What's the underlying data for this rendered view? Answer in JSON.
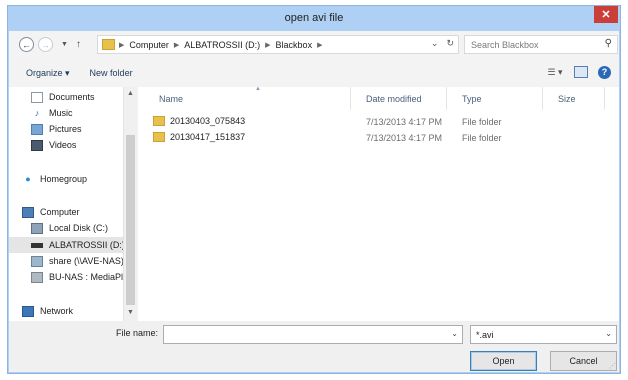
{
  "window": {
    "title": "open avi file",
    "close_glyph": "✕"
  },
  "nav": {
    "back_icon": "arrow-left-icon",
    "forward_icon": "arrow-right-icon",
    "breadcrumbs": [
      "Computer",
      "ALBATROSSII (D:)",
      "Blackbox"
    ],
    "search_placeholder": "Search Blackbox"
  },
  "toolbar": {
    "organize_label": "Organize ▾",
    "new_folder_label": "New folder"
  },
  "sidebar": {
    "items": [
      {
        "label": "Documents",
        "icon": "documents-icon",
        "group": "libraries"
      },
      {
        "label": "Music",
        "icon": "music-icon",
        "group": "libraries"
      },
      {
        "label": "Pictures",
        "icon": "pictures-icon",
        "group": "libraries"
      },
      {
        "label": "Videos",
        "icon": "videos-icon",
        "group": "libraries"
      },
      {
        "label": "Homegroup",
        "icon": "homegroup-icon",
        "group": "homegroup"
      },
      {
        "label": "Computer",
        "icon": "computer-icon",
        "group": "computer"
      },
      {
        "label": "Local Disk (C:)",
        "icon": "local-disk-icon",
        "group": "computer"
      },
      {
        "label": "ALBATROSSII (D:)",
        "icon": "drive-icon",
        "group": "computer",
        "selected": true
      },
      {
        "label": "share (\\\\AVE-NAS)",
        "icon": "network-drive-icon",
        "group": "computer"
      },
      {
        "label": "BU-NAS : MediaPlayer",
        "icon": "media-server-icon",
        "group": "computer"
      },
      {
        "label": "Network",
        "icon": "network-icon",
        "group": "network"
      }
    ]
  },
  "columns": [
    "Name",
    "Date modified",
    "Type",
    "Size"
  ],
  "files": [
    {
      "name": "20130403_075843",
      "date": "7/13/2013 4:17 PM",
      "type": "File folder",
      "size": ""
    },
    {
      "name": "20130417_151837",
      "date": "7/13/2013 4:17 PM",
      "type": "File folder",
      "size": ""
    }
  ],
  "footer": {
    "file_name_label": "File name:",
    "file_name_value": "",
    "file_type_value": "*.avi",
    "open_label": "Open",
    "cancel_label": "Cancel"
  },
  "colors": {
    "title_bar": "#aed0f5",
    "close_button": "#c9403a",
    "folder": "#e8c14a"
  }
}
